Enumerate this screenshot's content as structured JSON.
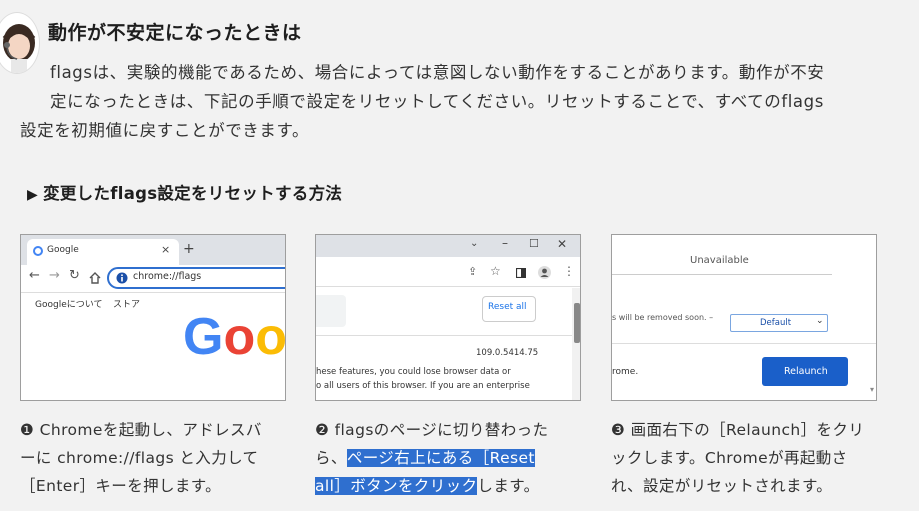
{
  "title": "動作が不安定になったときは",
  "intro": {
    "line1": "flagsは、実験的機能であるため、場合によっては意図しない動作をすることがあります。動作が不安",
    "line2": "定になったときは、下記の手順で設定をリセットしてください。リセットすることで、すべてのflags",
    "line3": "設定を初期値に戻すことができます。"
  },
  "section": {
    "marker": "▶",
    "title": "変更したflags設定をリセットする方法"
  },
  "shot1": {
    "tab": "Google",
    "tab_close": "×",
    "new_tab": "+",
    "address": "chrome://flags",
    "links": [
      "Googleについて",
      "ストア"
    ],
    "logo": [
      "G",
      "o",
      "o"
    ],
    "logo_colors": [
      "#4285f4",
      "#ea4335",
      "#fbbc05"
    ]
  },
  "shot2": {
    "reset_button": "Reset all",
    "version": "109.0.5414.75",
    "text1": "hese features, you could lose browser data or",
    "text2": "o all users of this browser. If you are an enterprise"
  },
  "shot3": {
    "unavailable": "Unavailable",
    "removed_text": "s will be removed soon. –",
    "select_value": "Default",
    "chrome_text": "rome.",
    "relaunch_button": "Relaunch"
  },
  "captions": {
    "c1": {
      "num": "❶",
      "l1": " Chromeを起動し、アドレスバ",
      "l2": "ーに chrome://flags と入力して",
      "l3": "［Enter］キーを押します。"
    },
    "c2": {
      "num": "❷",
      "l1": " flagsのページに切り替わった",
      "l2a": "ら、",
      "l2b": "ページ右上にある［Reset",
      "l3a": "all］ボタンをクリック",
      "l3b": "します。"
    },
    "c3": {
      "num": "❸",
      "l1": " 画面右下の［Relaunch］をクリ",
      "l2": "ックします。Chromeが再起動さ",
      "l3": "れ、設定がリセットされます。"
    }
  }
}
